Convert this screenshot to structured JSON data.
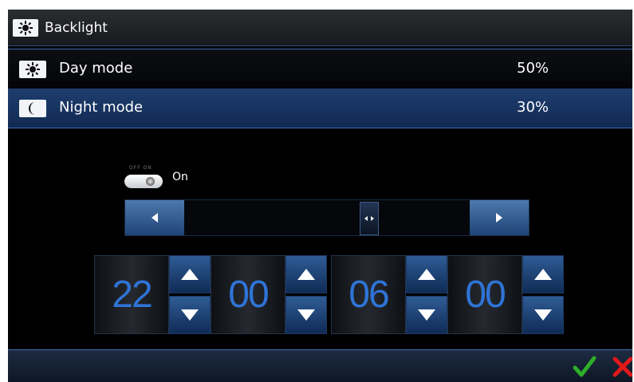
{
  "header": {
    "title": "Backlight"
  },
  "rows": [
    {
      "label": "Day mode",
      "value": "50%",
      "selected": false
    },
    {
      "label": "Night mode",
      "value": "30%",
      "selected": true
    }
  ],
  "toggle": {
    "off_label": "OFF",
    "on_label": "ON",
    "state_text": "On",
    "on": true
  },
  "slider": {
    "level_fraction": 0.66
  },
  "time": {
    "from_hours": "22",
    "from_minutes": "00",
    "to_hours": "06",
    "to_minutes": "00"
  },
  "colors": {
    "accent": "#3e6eae",
    "digits": "#2f74d6",
    "ok": "#2fae28",
    "cancel": "#e01a1a"
  },
  "icons": [
    "sun-icon",
    "moon-icon",
    "arrow-left-icon",
    "arrow-right-icon",
    "arrow-up-icon",
    "arrow-down-icon",
    "check-icon",
    "close-icon"
  ]
}
